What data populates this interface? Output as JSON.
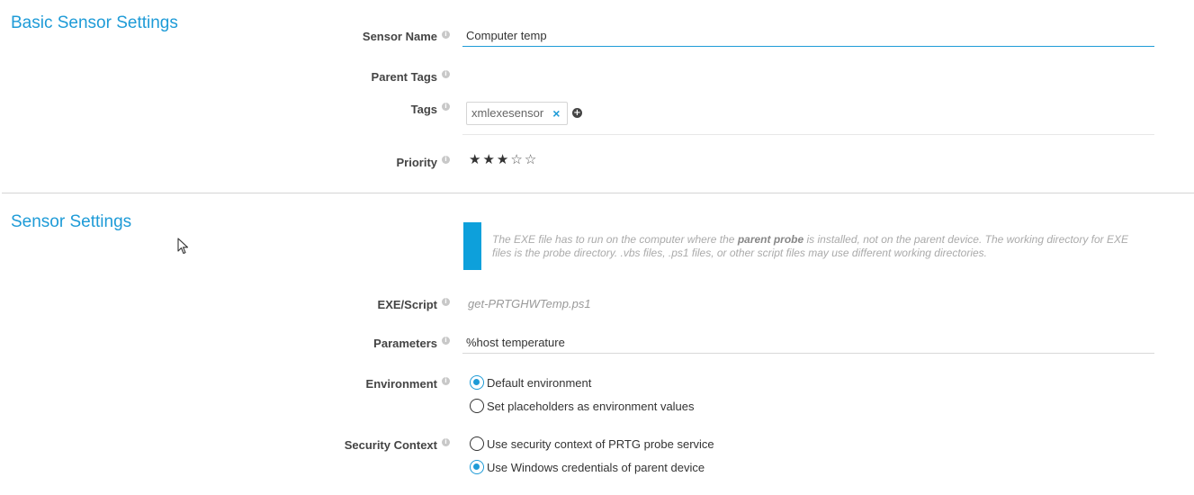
{
  "basic_section": {
    "title": "Basic Sensor Settings",
    "sensor_name": {
      "label": "Sensor Name",
      "value": "Computer temp"
    },
    "parent_tags": {
      "label": "Parent Tags"
    },
    "tags": {
      "label": "Tags",
      "items": [
        "xmlexesensor"
      ],
      "remove_symbol": "×",
      "add_symbol": "+"
    },
    "priority": {
      "label": "Priority",
      "value": 3,
      "max": 5,
      "filled_star": "★",
      "empty_star": "☆"
    }
  },
  "sensor_section": {
    "title": "Sensor Settings",
    "info": {
      "before": "The EXE file has to run on the computer where the ",
      "bold": "parent probe",
      "after": " is installed, not on the parent device. The working directory for EXE files is the probe directory. .vbs files, .ps1 files, or other script files may use different working directories."
    },
    "exe_script": {
      "label": "EXE/Script",
      "value": "get-PRTGHWTemp.ps1"
    },
    "parameters": {
      "label": "Parameters",
      "value": "%host temperature"
    },
    "environment": {
      "label": "Environment",
      "options": [
        "Default environment",
        "Set placeholders as environment values"
      ],
      "selected": 0
    },
    "security_context": {
      "label": "Security Context",
      "options": [
        "Use security context of PRTG probe service",
        "Use Windows credentials of parent device"
      ],
      "selected": 1
    }
  },
  "icons": {
    "info": "i"
  },
  "colors": {
    "accent": "#1e9bd7",
    "info_bar": "#0da0db"
  }
}
